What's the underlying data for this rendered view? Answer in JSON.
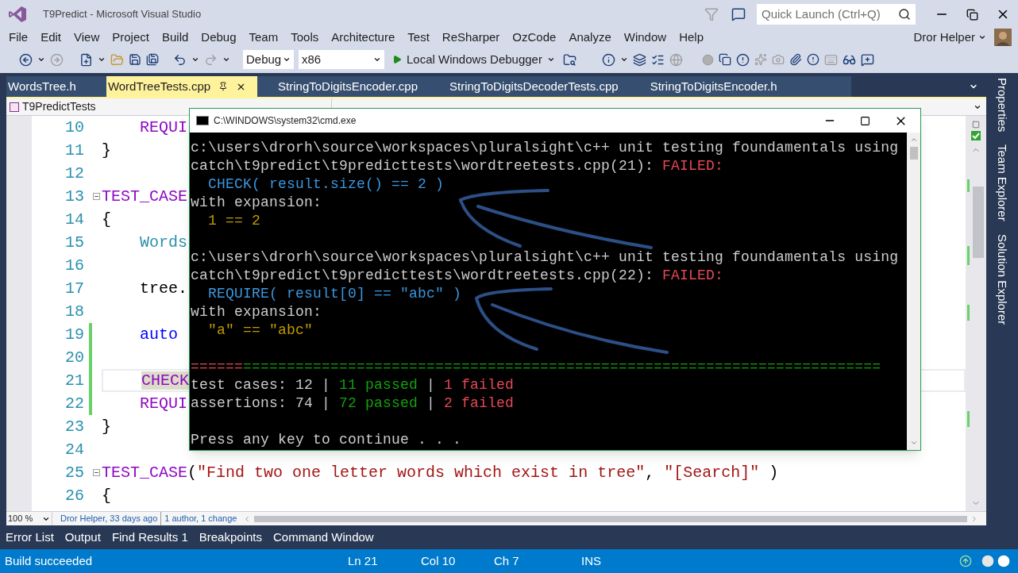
{
  "window": {
    "title": "T9Predict - Microsoft Visual Studio"
  },
  "quick_launch": {
    "placeholder": "Quick Launch (Ctrl+Q)"
  },
  "user": {
    "name": "Dror Helper"
  },
  "menu": [
    "File",
    "Edit",
    "View",
    "Project",
    "Build",
    "Debug",
    "Team",
    "Tools",
    "Architecture",
    "Test",
    "ReSharper",
    "OzCode",
    "Analyze",
    "Window",
    "Help"
  ],
  "toolbar": {
    "configuration": "Debug",
    "platform": "x86",
    "run_button": "Local Windows Debugger"
  },
  "tabs": [
    {
      "label": "WordsTree.h",
      "selected": false
    },
    {
      "label": "WordTreeTests.cpp",
      "selected": true
    },
    {
      "label": "StringToDigitsEncoder.cpp",
      "selected": false
    },
    {
      "label": "StringToDigitsDecoderTests.cpp",
      "selected": false
    },
    {
      "label": "StringToDigitsEncoder.h",
      "selected": false
    }
  ],
  "editor": {
    "project": "T9PredictTests",
    "lines": [
      {
        "number": "10",
        "modified": false,
        "current": false,
        "foldable": false,
        "segments": [
          {
            "text": "    REQUI",
            "color": "#8f08c4",
            "highlighted": false
          }
        ]
      },
      {
        "number": "11",
        "modified": false,
        "current": false,
        "foldable": false,
        "segments": [
          {
            "text": "}",
            "color": "#000000",
            "highlighted": false
          }
        ]
      },
      {
        "number": "12",
        "modified": false,
        "current": false,
        "foldable": false
      },
      {
        "number": "13",
        "modified": false,
        "current": false,
        "foldable": true,
        "segments": [
          {
            "text": "TEST_CASE",
            "color": "#8f08c4",
            "highlighted": false
          }
        ]
      },
      {
        "number": "14",
        "modified": false,
        "current": false,
        "foldable": false,
        "segments": [
          {
            "text": "{",
            "color": "#000000",
            "highlighted": false
          }
        ]
      },
      {
        "number": "15",
        "modified": false,
        "current": false,
        "foldable": false,
        "segments": [
          {
            "text": "    Words",
            "color": "#2b91af",
            "highlighted": false
          }
        ]
      },
      {
        "number": "16",
        "modified": false,
        "current": false,
        "foldable": false
      },
      {
        "number": "17",
        "modified": false,
        "current": false,
        "foldable": false,
        "segments": [
          {
            "text": "    tree.",
            "color": "#000000",
            "highlighted": false
          }
        ]
      },
      {
        "number": "18",
        "modified": false,
        "current": false,
        "foldable": false
      },
      {
        "number": "19",
        "modified": true,
        "current": false,
        "foldable": false,
        "segments": [
          {
            "text": "    auto",
            "color": "#0000ff",
            "highlighted": false
          }
        ]
      },
      {
        "number": "20",
        "modified": true,
        "current": false,
        "foldable": false
      },
      {
        "number": "21",
        "modified": true,
        "current": true,
        "foldable": false,
        "segments": [
          {
            "text": "    CHECK",
            "color": "#8f08c4",
            "highlighted": true
          }
        ]
      },
      {
        "number": "22",
        "modified": true,
        "current": false,
        "foldable": false,
        "segments": [
          {
            "text": "    REQUI",
            "color": "#8f08c4",
            "highlighted": false
          }
        ]
      },
      {
        "number": "23",
        "modified": false,
        "current": false,
        "foldable": false,
        "segments": [
          {
            "text": "}",
            "color": "#000000",
            "highlighted": false
          }
        ]
      },
      {
        "number": "24",
        "modified": false,
        "current": false,
        "foldable": false
      },
      {
        "number": "25",
        "modified": false,
        "current": false,
        "foldable": true,
        "segments": [
          {
            "text": "TEST_CASE",
            "color": "#8f08c4",
            "highlighted": false
          },
          {
            "text": "(",
            "color": "#000000",
            "highlighted": false
          },
          {
            "text": "\"Find two one letter words which exist in tree\"",
            "color": "#a31515",
            "highlighted": false
          },
          {
            "text": ", ",
            "color": "#000000",
            "highlighted": false
          },
          {
            "text": "\"[Search]\"",
            "color": "#a31515",
            "highlighted": false
          },
          {
            "text": " )",
            "color": "#000000",
            "highlighted": false
          }
        ]
      },
      {
        "number": "26",
        "modified": false,
        "current": false,
        "foldable": false,
        "segments": [
          {
            "text": "{",
            "color": "#000000",
            "highlighted": false
          }
        ]
      }
    ]
  },
  "zoom": "100 %",
  "code_lens": {
    "author": "Dror Helper, 33 days ago",
    "changes": "1 author, 1 change"
  },
  "side_panels": [
    "Properties",
    "Team Explorer",
    "Solution Explorer"
  ],
  "tool_tabs": [
    "Error List",
    "Output",
    "Find Results 1",
    "Breakpoints",
    "Command Window"
  ],
  "status_bar": {
    "message": "Build succeeded",
    "line": "Ln 21",
    "column": "Col 10",
    "char": "Ch 7",
    "mode": "INS"
  },
  "console": {
    "title": "C:\\WINDOWS\\system32\\cmd.exe",
    "lines": [
      {
        "kind": "text",
        "segments": [
          {
            "text": "c:\\users\\drorh\\source\\workspaces\\pluralsight\\c++ unit testing foundamentals using",
            "color": "#cccccc"
          }
        ]
      },
      {
        "kind": "text",
        "segments": [
          {
            "text": "catch\\t9predict\\t9predicttests\\wordtreetests.cpp(21): ",
            "color": "#cccccc"
          },
          {
            "text": "FAILED:",
            "color": "#e74856"
          }
        ]
      },
      {
        "kind": "text",
        "segments": [
          {
            "text": "  CHECK( result.size() == 2 )",
            "color": "#3a96dd"
          }
        ]
      },
      {
        "kind": "text",
        "segments": [
          {
            "text": "with expansion:",
            "color": "#cccccc"
          }
        ]
      },
      {
        "kind": "text",
        "segments": [
          {
            "text": "  1 == 2",
            "color": "#c19c00"
          }
        ]
      },
      {
        "kind": "blank"
      },
      {
        "kind": "text",
        "segments": [
          {
            "text": "c:\\users\\drorh\\source\\workspaces\\pluralsight\\c++ unit testing foundamentals using",
            "color": "#cccccc"
          }
        ]
      },
      {
        "kind": "text",
        "segments": [
          {
            "text": "catch\\t9predict\\t9predicttests\\wordtreetests.cpp(22): ",
            "color": "#cccccc"
          },
          {
            "text": "FAILED:",
            "color": "#e74856"
          }
        ]
      },
      {
        "kind": "text",
        "segments": [
          {
            "text": "  REQUIRE( result[0] == \"abc\" )",
            "color": "#3a96dd"
          }
        ]
      },
      {
        "kind": "text",
        "segments": [
          {
            "text": "with expansion:",
            "color": "#cccccc"
          }
        ]
      },
      {
        "kind": "text",
        "segments": [
          {
            "text": "  \"a\" == \"abc\"",
            "color": "#c19c00"
          }
        ]
      },
      {
        "kind": "blank"
      },
      {
        "kind": "text",
        "segments": [
          {
            "text": "======",
            "color": "#e74856"
          },
          {
            "text": "=========================================================================",
            "color": "#13a10e"
          }
        ]
      },
      {
        "kind": "text",
        "segments": [
          {
            "text": "test cases: 12 | ",
            "color": "#cccccc"
          },
          {
            "text": "11 passed",
            "color": "#13a10e"
          },
          {
            "text": " | ",
            "color": "#cccccc"
          },
          {
            "text": "1 failed",
            "color": "#e74856"
          }
        ]
      },
      {
        "kind": "text",
        "segments": [
          {
            "text": "assertions: 74 | ",
            "color": "#cccccc"
          },
          {
            "text": "72 passed",
            "color": "#13a10e"
          },
          {
            "text": " | ",
            "color": "#cccccc"
          },
          {
            "text": "2 failed",
            "color": "#e74856"
          }
        ]
      },
      {
        "kind": "blank"
      },
      {
        "kind": "text",
        "segments": [
          {
            "text": "Press any key to continue . . .",
            "color": "#cccccc"
          }
        ]
      }
    ]
  }
}
